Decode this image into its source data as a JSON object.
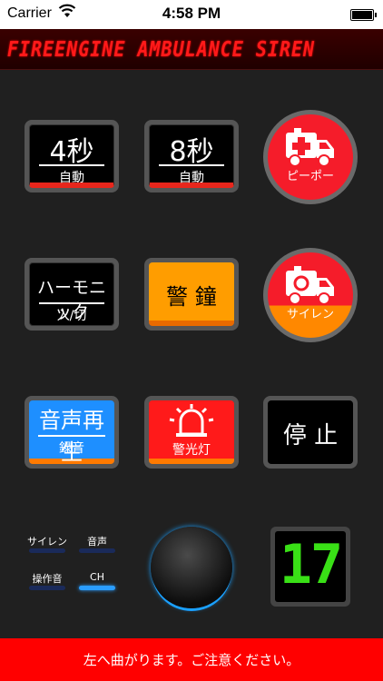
{
  "status_bar": {
    "carrier": "Carrier",
    "time": "4:58 PM",
    "wifi_icon": "wifi-icon",
    "battery_icon": "battery-icon"
  },
  "title": "FIREENGINE AMBULANCE SIREN",
  "buttons": {
    "auto4": {
      "main": "4秒",
      "sub": "自動"
    },
    "auto8": {
      "main": "8秒",
      "sub": "自動"
    },
    "pipo": {
      "label": "ピーポー",
      "icon": "ambulance-cross-icon"
    },
    "harmonic": {
      "main": "ハーモニック",
      "sub": "入/切"
    },
    "keisho": {
      "main": "警 鐘"
    },
    "siren": {
      "label": "サイレン",
      "icon": "ambulance-siren-icon"
    },
    "record": {
      "main": "音声再生",
      "sub": "録音"
    },
    "light": {
      "sub": "警光灯",
      "icon": "beacon-light-icon"
    },
    "stop": {
      "main": "停 止"
    }
  },
  "small_controls": {
    "siren": "サイレン",
    "voice": "音声",
    "op_sound": "操作音",
    "ch": "CH"
  },
  "counter_value": "17",
  "footer_message": "左へ曲がります。ご注意ください。",
  "colors": {
    "red": "#f51c2a",
    "orange": "#ff9d00",
    "blue": "#1e8fff",
    "green_lcd": "#39e016"
  }
}
